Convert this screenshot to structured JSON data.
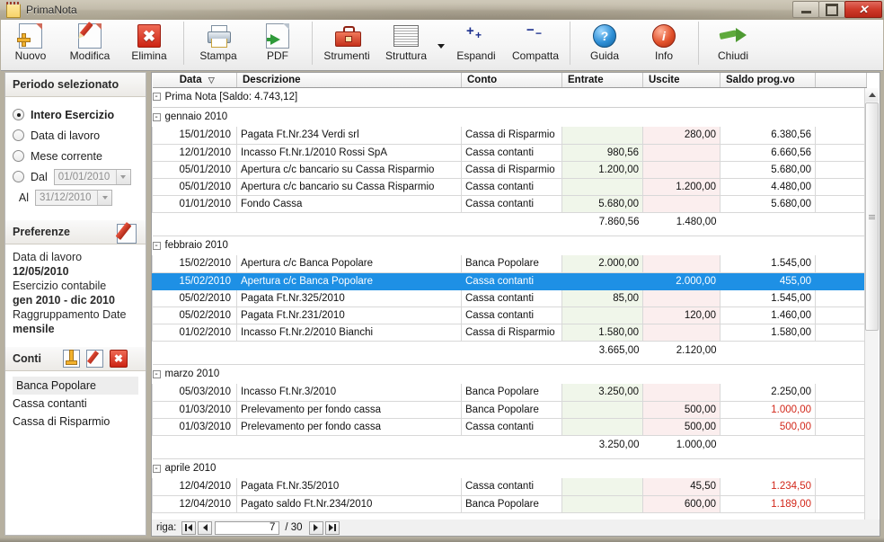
{
  "window": {
    "title": "PrimaNota",
    "icon": "notepad-icon",
    "minimize_label": "",
    "maximize_label": "",
    "close_label": "✕"
  },
  "toolbar": {
    "buttons": [
      {
        "label": "Nuovo",
        "icon": "new-document-icon"
      },
      {
        "label": "Modifica",
        "icon": "edit-pencil-icon"
      },
      {
        "label": "Elimina",
        "icon": "delete-x-icon"
      },
      {
        "label": "Stampa",
        "icon": "printer-icon"
      },
      {
        "label": "PDF",
        "icon": "pdf-export-icon"
      },
      {
        "label": "Strumenti",
        "icon": "toolbox-icon"
      },
      {
        "label": "Struttura",
        "icon": "layout-lines-icon"
      },
      {
        "label": "Espandi",
        "icon": "expand-plus-icon"
      },
      {
        "label": "Compatta",
        "icon": "collapse-minus-icon"
      },
      {
        "label": "Guida",
        "icon": "help-question-icon"
      },
      {
        "label": "Info",
        "icon": "info-icon"
      },
      {
        "label": "Chiudi",
        "icon": "exit-arrow-icon"
      }
    ]
  },
  "sidebar": {
    "period": {
      "header": "Periodo selezionato",
      "options": [
        {
          "label": "Intero Esercizio",
          "selected": true
        },
        {
          "label": "Data di lavoro",
          "selected": false
        },
        {
          "label": "Mese corrente",
          "selected": false
        },
        {
          "label": "Dal",
          "selected": false
        }
      ],
      "dal_value": "01/01/2010",
      "al_label": "Al",
      "al_value": "31/12/2010"
    },
    "preferences": {
      "header": "Preferenze",
      "edit_icon": "edit-pencil-icon",
      "work_date_label": "Data di lavoro",
      "work_date_value": "12/05/2010",
      "exercise_label": "Esercizio contabile",
      "exercise_value": "gen 2010 - dic 2010",
      "grouping_label": "Raggruppamento Date",
      "grouping_value": "mensile"
    },
    "accounts": {
      "header": "Conti",
      "add_icon": "add-document-icon",
      "edit_icon": "edit-pencil-icon",
      "delete_icon": "delete-x-icon",
      "items": [
        {
          "label": "Banca Popolare",
          "highlighted": true
        },
        {
          "label": "Cassa contanti",
          "highlighted": false
        },
        {
          "label": "Cassa di Risparmio",
          "highlighted": false
        }
      ]
    }
  },
  "grid": {
    "columns": [
      "Data",
      "Descrizione",
      "Conto",
      "Entrate",
      "Uscite",
      "Saldo prog.vo"
    ],
    "sort_column": "Data",
    "sort_indicator": "▽",
    "root": {
      "toggle": "-",
      "label": "Prima Nota  [Saldo: 4.743,12]"
    },
    "groups": [
      {
        "toggle": "-",
        "label": "gennaio 2010",
        "rows": [
          {
            "data": "15/01/2010",
            "descrizione": "Pagata Ft.Nr.234 Verdi srl",
            "conto": "Cassa di Risparmio",
            "entrate": "",
            "uscite": "280,00",
            "saldo": "6.380,56",
            "saldo_negative": false,
            "selected": false
          },
          {
            "data": "12/01/2010",
            "descrizione": "Incasso Ft.Nr.1/2010 Rossi SpA",
            "conto": "Cassa contanti",
            "entrate": "980,56",
            "uscite": "",
            "saldo": "6.660,56",
            "saldo_negative": false,
            "selected": false
          },
          {
            "data": "05/01/2010",
            "descrizione": "Apertura c/c bancario su Cassa Risparmio",
            "conto": "Cassa di Risparmio",
            "entrate": "1.200,00",
            "uscite": "",
            "saldo": "5.680,00",
            "saldo_negative": false,
            "selected": false
          },
          {
            "data": "05/01/2010",
            "descrizione": "Apertura c/c bancario su Cassa Risparmio",
            "conto": "Cassa contanti",
            "entrate": "",
            "uscite": "1.200,00",
            "saldo": "4.480,00",
            "saldo_negative": false,
            "selected": false
          },
          {
            "data": "01/01/2010",
            "descrizione": "Fondo Cassa",
            "conto": "Cassa contanti",
            "entrate": "5.680,00",
            "uscite": "",
            "saldo": "5.680,00",
            "saldo_negative": false,
            "selected": false
          }
        ],
        "total_entrate": "7.860,56",
        "total_uscite": "1.480,00"
      },
      {
        "toggle": "-",
        "label": "febbraio 2010",
        "rows": [
          {
            "data": "15/02/2010",
            "descrizione": "Apertura c/c Banca Popolare",
            "conto": "Banca Popolare",
            "entrate": "2.000,00",
            "uscite": "",
            "saldo": "1.545,00",
            "saldo_negative": false,
            "selected": false
          },
          {
            "data": "15/02/2010",
            "descrizione": "Apertura c/c Banca Popolare",
            "conto": "Cassa contanti",
            "entrate": "",
            "uscite": "2.000,00",
            "saldo": "455,00",
            "saldo_negative": false,
            "selected": true
          },
          {
            "data": "05/02/2010",
            "descrizione": "Pagata Ft.Nr.325/2010",
            "conto": "Cassa contanti",
            "entrate": "85,00",
            "uscite": "",
            "saldo": "1.545,00",
            "saldo_negative": false,
            "selected": false
          },
          {
            "data": "05/02/2010",
            "descrizione": "Pagata Ft.Nr.231/2010",
            "conto": "Cassa contanti",
            "entrate": "",
            "uscite": "120,00",
            "saldo": "1.460,00",
            "saldo_negative": false,
            "selected": false
          },
          {
            "data": "01/02/2010",
            "descrizione": "Incasso Ft.Nr.2/2010 Bianchi",
            "conto": "Cassa di Risparmio",
            "entrate": "1.580,00",
            "uscite": "",
            "saldo": "1.580,00",
            "saldo_negative": false,
            "selected": false
          }
        ],
        "total_entrate": "3.665,00",
        "total_uscite": "2.120,00"
      },
      {
        "toggle": "-",
        "label": "marzo 2010",
        "rows": [
          {
            "data": "05/03/2010",
            "descrizione": "Incasso Ft.Nr.3/2010",
            "conto": "Banca Popolare",
            "entrate": "3.250,00",
            "uscite": "",
            "saldo": "2.250,00",
            "saldo_negative": false,
            "selected": false
          },
          {
            "data": "01/03/2010",
            "descrizione": "Prelevamento per fondo cassa",
            "conto": "Banca Popolare",
            "entrate": "",
            "uscite": "500,00",
            "saldo": "1.000,00",
            "saldo_negative": true,
            "selected": false
          },
          {
            "data": "01/03/2010",
            "descrizione": "Prelevamento per fondo cassa",
            "conto": "Cassa contanti",
            "entrate": "",
            "uscite": "500,00",
            "saldo": "500,00",
            "saldo_negative": true,
            "selected": false
          }
        ],
        "total_entrate": "3.250,00",
        "total_uscite": "1.000,00"
      },
      {
        "toggle": "-",
        "label": "aprile 2010",
        "rows": [
          {
            "data": "12/04/2010",
            "descrizione": "Pagata Ft.Nr.35/2010",
            "conto": "Cassa contanti",
            "entrate": "",
            "uscite": "45,50",
            "saldo": "1.234,50",
            "saldo_negative": true,
            "selected": false
          },
          {
            "data": "12/04/2010",
            "descrizione": "Pagato saldo Ft.Nr.234/2010",
            "conto": "Banca Popolare",
            "entrate": "",
            "uscite": "600,00",
            "saldo": "1.189,00",
            "saldo_negative": true,
            "selected": false
          }
        ],
        "total_entrate": "",
        "total_uscite": ""
      }
    ]
  },
  "statusbar": {
    "label": "riga:",
    "current_row": "7",
    "separator": "/ 30",
    "first_icon": "first-record-icon",
    "prev_icon": "prev-record-icon",
    "next_icon": "next-record-icon",
    "last_icon": "last-record-icon"
  }
}
